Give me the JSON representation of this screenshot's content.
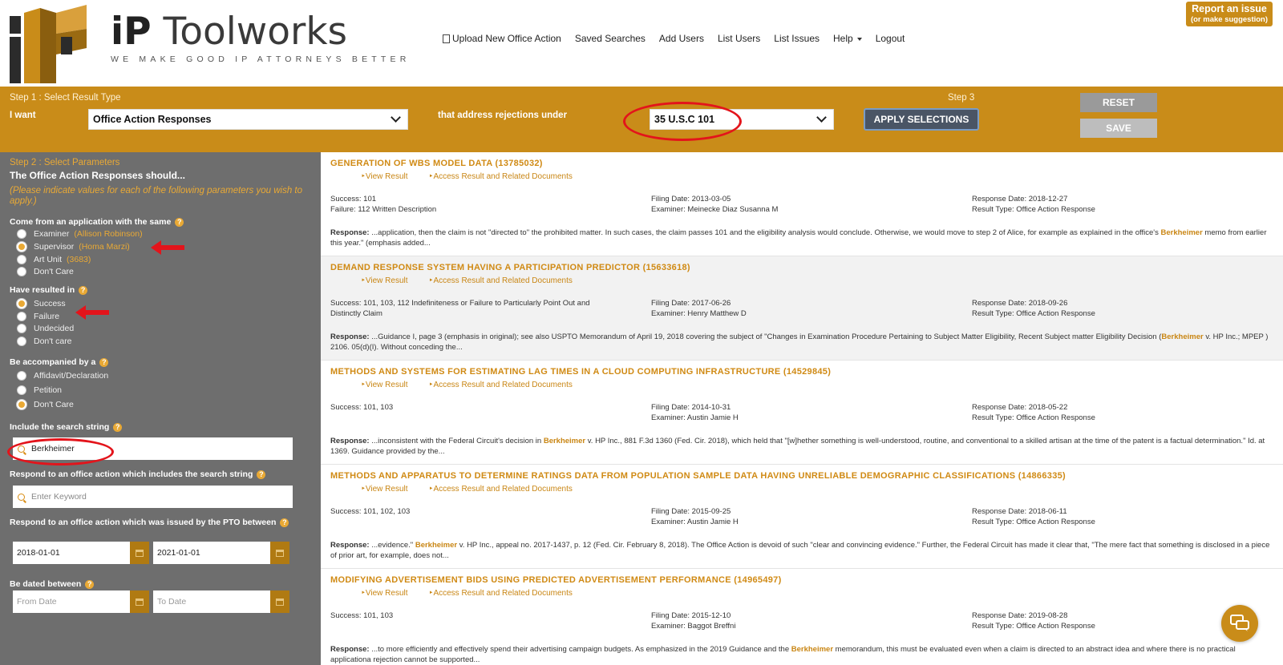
{
  "header": {
    "brand_ip": "iP",
    "brand_rest": "Toolworks",
    "tagline": "WE MAKE GOOD IP ATTORNEYS BETTER",
    "nav": [
      "Upload New Office Action",
      "Saved Searches",
      "Add Users",
      "List Users",
      "List Issues",
      "Help",
      "Logout"
    ],
    "report_line1": "Report an issue",
    "report_line2": "(or make suggestion)"
  },
  "bar": {
    "step1": "Step 1 : Select Result Type",
    "i_want": "I want",
    "result_type": "Office Action Responses",
    "address_label": "that address rejections under",
    "statute": "35 U.S.C 101",
    "step3": "Step 3",
    "apply": "APPLY SELECTIONS",
    "reset": "RESET",
    "save": "SAVE"
  },
  "sidebar": {
    "step2": "Step 2 : Select Parameters",
    "title": "The Office Action Responses should...",
    "note": "(Please indicate values for each of the following parameters you wish to apply.)",
    "q_same": "Come from an application with the same",
    "examiner": "Examiner",
    "examiner_val": "(Allison Robinson)",
    "supervisor": "Supervisor",
    "supervisor_val": "(Homa Marzi)",
    "art_unit": "Art Unit",
    "art_unit_val": "(3683)",
    "dont_care": "Don't Care",
    "q_resulted": "Have resulted in",
    "success": "Success",
    "failure": "Failure",
    "undecided": "Undecided",
    "dont_care_lc": "Don't care",
    "q_accompanied": "Be accompanied by a",
    "affidavit": "Affidavit/Declaration",
    "petition": "Petition",
    "q_search": "Include the search string",
    "search_value": "Berkheimer",
    "q_respond": "Respond to an office action which includes the search string",
    "keyword_placeholder": "Enter Keyword",
    "q_issued": "Respond to an office action which was issued by the PTO between",
    "issued_from": "2018-01-01",
    "issued_to": "2021-01-01",
    "q_dated": "Be dated between",
    "from_placeholder": "From Date",
    "to_placeholder": "To Date"
  },
  "results": [
    {
      "title": "GENERATION OF WBS MODEL DATA (13785032)",
      "view": "View Result",
      "access": "Access Result and Related Documents",
      "c1a": "Success: 101",
      "c1b": "Failure: 112 Written Description",
      "c2a": "Filing Date: 2013-03-05",
      "c2b": "Examiner: Meinecke Diaz Susanna M",
      "c3a": "Response Date: 2018-12-27",
      "c3b": "Result Type: Office Action Response",
      "resp_label": "Response:",
      "resp_pre": " ...application, then the claim is not \"directed to\" the prohibited matter. In such cases, the claim passes 101 and the eligibility analysis would conclude. Otherwise, we would move to step 2 of Alice, for example as explained in the office's ",
      "resp_hl": "Berkheimer",
      "resp_post": " memo from earlier this year.\" (emphasis added..."
    },
    {
      "title": "DEMAND RESPONSE SYSTEM HAVING A PARTICIPATION PREDICTOR (15633618)",
      "view": "View Result",
      "access": "Access Result and Related Documents",
      "c1a": "Success: 101, 103, 112 Indefiniteness or Failure to Particularly Point Out and Distinctly Claim",
      "c1b": "",
      "c2a": "Filing Date: 2017-06-26",
      "c2b": "Examiner: Henry Matthew D",
      "c3a": "Response Date: 2018-09-26",
      "c3b": "Result Type: Office Action Response",
      "resp_label": "Response:",
      "resp_pre": " ...Guidance I, page 3 (emphasis in original); see also USPTO Memorandum of April 19, 2018 covering the subject of \"Changes in Examination Procedure Pertaining to Subject Matter Eligibility, Recent Subject matter Eligibility Decision (",
      "resp_hl": "Berkheimer",
      "resp_post": " v. HP Inc.; MPEP ) 2106. 05(d)(I). Without conceding the..."
    },
    {
      "title": "METHODS AND SYSTEMS FOR ESTIMATING LAG TIMES IN A CLOUD COMPUTING INFRASTRUCTURE (14529845)",
      "view": "View Result",
      "access": "Access Result and Related Documents",
      "c1a": "Success: 101, 103",
      "c1b": "",
      "c2a": "Filing Date: 2014-10-31",
      "c2b": "Examiner: Austin Jamie H",
      "c3a": "Response Date: 2018-05-22",
      "c3b": "Result Type: Office Action Response",
      "resp_label": "Response:",
      "resp_pre": " ...inconsistent with the Federal Circuit's decision in ",
      "resp_hl": "Berkheimer",
      "resp_post": " v. HP Inc., 881 F.3d 1360 (Fed. Cir. 2018), which held that \"[w]hether something is well-understood, routine, and conventional to a skilled artisan at the time of the patent is a factual determination.\" Id. at 1369. Guidance provided by the..."
    },
    {
      "title": "METHODS AND APPARATUS TO DETERMINE RATINGS DATA FROM POPULATION SAMPLE DATA HAVING UNRELIABLE DEMOGRAPHIC CLASSIFICATIONS (14866335)",
      "view": "View Result",
      "access": "Access Result and Related Documents",
      "c1a": "Success: 101, 102, 103",
      "c1b": "",
      "c2a": "Filing Date: 2015-09-25",
      "c2b": "Examiner: Austin Jamie H",
      "c3a": "Response Date: 2018-06-11",
      "c3b": "Result Type: Office Action Response",
      "resp_label": "Response:",
      "resp_pre": " ...evidence.\" ",
      "resp_hl": "Berkheimer",
      "resp_post": " v. HP Inc., appeal no. 2017-1437, p. 12 (Fed. Cir. February 8, 2018). The Office Action is devoid of such \"clear and convincing evidence.\" Further, the Federal Circuit has made it clear that, \"The mere fact that something is disclosed in a piece of prior art, for example, does not..."
    },
    {
      "title": "MODIFYING ADVERTISEMENT BIDS USING PREDICTED ADVERTISEMENT PERFORMANCE (14965497)",
      "view": "View Result",
      "access": "Access Result and Related Documents",
      "c1a": "Success: 101, 103",
      "c1b": "",
      "c2a": "Filing Date: 2015-12-10",
      "c2b": "Examiner: Baggot Breffni",
      "c3a": "Response Date: 2019-08-28",
      "c3b": "Result Type: Office Action Response",
      "resp_label": "Response:",
      "resp_pre": " ...to more efficiently and effectively spend their advertising campaign budgets. As emphasized in the 2019 Guidance and the ",
      "resp_hl": "Berkheimer",
      "resp_post": " memorandum, this must be evaluated even when a claim is directed to an abstract idea and where there is no practical applicationa rejection cannot be supported..."
    }
  ]
}
